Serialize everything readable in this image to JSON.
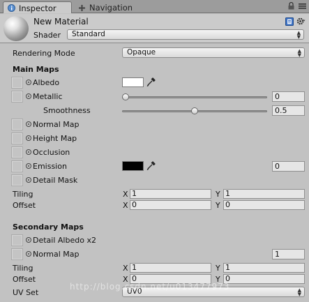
{
  "tabs": [
    {
      "label": "Inspector",
      "icon": "inspector-icon",
      "active": true
    },
    {
      "label": "Navigation",
      "icon": "navigation-icon",
      "active": false
    }
  ],
  "header": {
    "material_name": "New Material",
    "shader_label": "Shader",
    "shader_value": "Standard"
  },
  "rendering_mode": {
    "label": "Rendering Mode",
    "value": "Opaque"
  },
  "main_maps": {
    "title": "Main Maps",
    "albedo": {
      "label": "Albedo",
      "color": "#ffffff"
    },
    "metallic": {
      "label": "Metallic",
      "value": "0",
      "slider_fraction": 0
    },
    "smoothness": {
      "label": "Smoothness",
      "value": "0.5",
      "slider_fraction": 0.5
    },
    "normal_map": {
      "label": "Normal Map"
    },
    "height_map": {
      "label": "Height Map"
    },
    "occlusion": {
      "label": "Occlusion"
    },
    "emission": {
      "label": "Emission",
      "color": "#000000",
      "value": "0"
    },
    "detail_mask": {
      "label": "Detail Mask"
    },
    "tiling": {
      "label": "Tiling",
      "x_axis": "X",
      "x": "1",
      "y_axis": "Y",
      "y": "1"
    },
    "offset": {
      "label": "Offset",
      "x_axis": "X",
      "x": "0",
      "y_axis": "Y",
      "y": "0"
    }
  },
  "secondary_maps": {
    "title": "Secondary Maps",
    "detail_albedo": {
      "label": "Detail Albedo x2"
    },
    "normal_map": {
      "label": "Normal Map",
      "value": "1"
    },
    "tiling": {
      "label": "Tiling",
      "x_axis": "X",
      "x": "1",
      "y_axis": "Y",
      "y": "1"
    },
    "offset": {
      "label": "Offset",
      "x_axis": "X",
      "x": "0",
      "y_axis": "Y",
      "y": "0"
    },
    "uv_set": {
      "label": "UV Set",
      "value": "UV0"
    }
  },
  "watermark": "http://blog.csdn.net/u013477973",
  "colors": {
    "panel": "#c2c2c2",
    "tabbar": "#9c9c9c",
    "field": "#e6e6e6"
  }
}
